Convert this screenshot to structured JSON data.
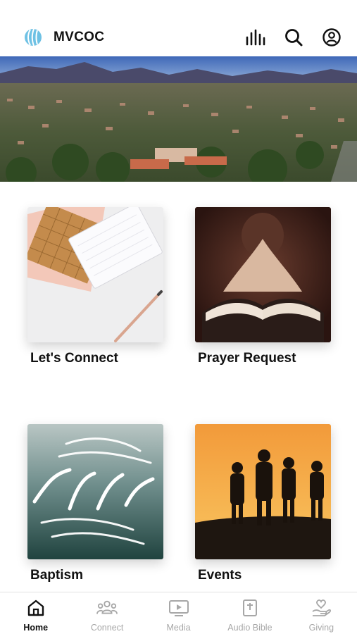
{
  "header": {
    "title": "MVCOC",
    "logo_icon": "globe-logo-icon",
    "actions": [
      {
        "icon": "audio-bars-icon"
      },
      {
        "icon": "search-icon"
      },
      {
        "icon": "account-circle-icon"
      }
    ]
  },
  "hero": {
    "image": "aerial-town-mountains-photo"
  },
  "tiles": [
    {
      "label": "Let's Connect",
      "image": "notebook-pencil-photo"
    },
    {
      "label": "Prayer Request",
      "image": "praying-hands-bible-photo"
    },
    {
      "label": "Baptism",
      "image": "baptism-lettering-ocean-photo"
    },
    {
      "label": "Events",
      "image": "family-silhouette-sunset-photo"
    }
  ],
  "tabbar": {
    "active": "Home",
    "tabs": [
      {
        "label": "Home",
        "icon": "home-icon"
      },
      {
        "label": "Connect",
        "icon": "people-icon"
      },
      {
        "label": "Media",
        "icon": "tv-play-icon"
      },
      {
        "label": "Audio Bible",
        "icon": "bible-icon"
      },
      {
        "label": "Giving",
        "icon": "heart-hand-icon"
      }
    ]
  },
  "colors": {
    "active_tab": "#111111",
    "inactive_tab": "#a7a7a7",
    "divider": "#e2e2e2"
  }
}
